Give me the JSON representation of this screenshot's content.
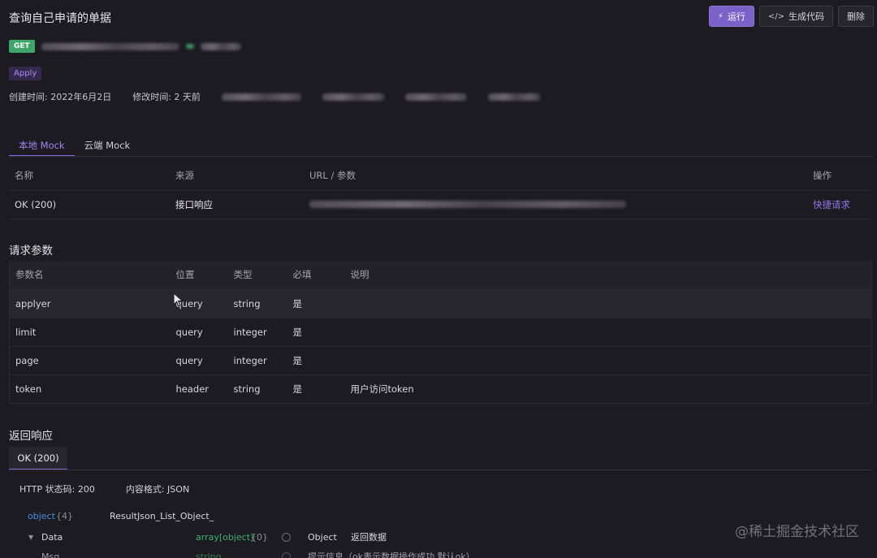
{
  "header": {
    "title": "查询自己申请的单据",
    "run_label": "运行",
    "codegen_label": "生成代码",
    "delete_label": "删除"
  },
  "endpoint": {
    "method": "GET",
    "tag": "Apply"
  },
  "meta": {
    "created": "创建时间: 2022年6月2日",
    "modified": "修改时间: 2 天前"
  },
  "mock_tabs": [
    "本地 Mock",
    "云端 Mock"
  ],
  "mock_table": {
    "headers": [
      "名称",
      "来源",
      "URL / 参数",
      "操作"
    ],
    "rows": [
      {
        "name": "OK (200)",
        "source": "接口响应",
        "action": "快捷请求"
      }
    ]
  },
  "request_params": {
    "title": "请求参数",
    "headers": [
      "参数名",
      "位置",
      "类型",
      "必填",
      "说明"
    ],
    "rows": [
      {
        "name": "applyer",
        "location": "query",
        "type": "string",
        "required": "是",
        "desc": ""
      },
      {
        "name": "limit",
        "location": "query",
        "type": "integer",
        "required": "是",
        "desc": ""
      },
      {
        "name": "page",
        "location": "query",
        "type": "integer",
        "required": "是",
        "desc": ""
      },
      {
        "name": "token",
        "location": "header",
        "type": "string",
        "required": "是",
        "desc": "用户访问token"
      }
    ]
  },
  "response": {
    "title": "返回响应",
    "tab": "OK (200)",
    "status_code": "HTTP 状态码: 200",
    "content_type": "内容格式: JSON",
    "tree": {
      "root_type": "object",
      "root_count": "{4}",
      "root_name": "ResultJson_List_Object_",
      "child_name": "Data",
      "child_type": "array[object]",
      "child_count": "{0}",
      "child_item": "Object",
      "child_desc": "返回数据",
      "next_name": "Msg",
      "next_type": "string",
      "next_desc": "提示信息（ok表示数据操作成功,默认ok）"
    }
  },
  "watermark": "@稀土掘金技术社区"
}
